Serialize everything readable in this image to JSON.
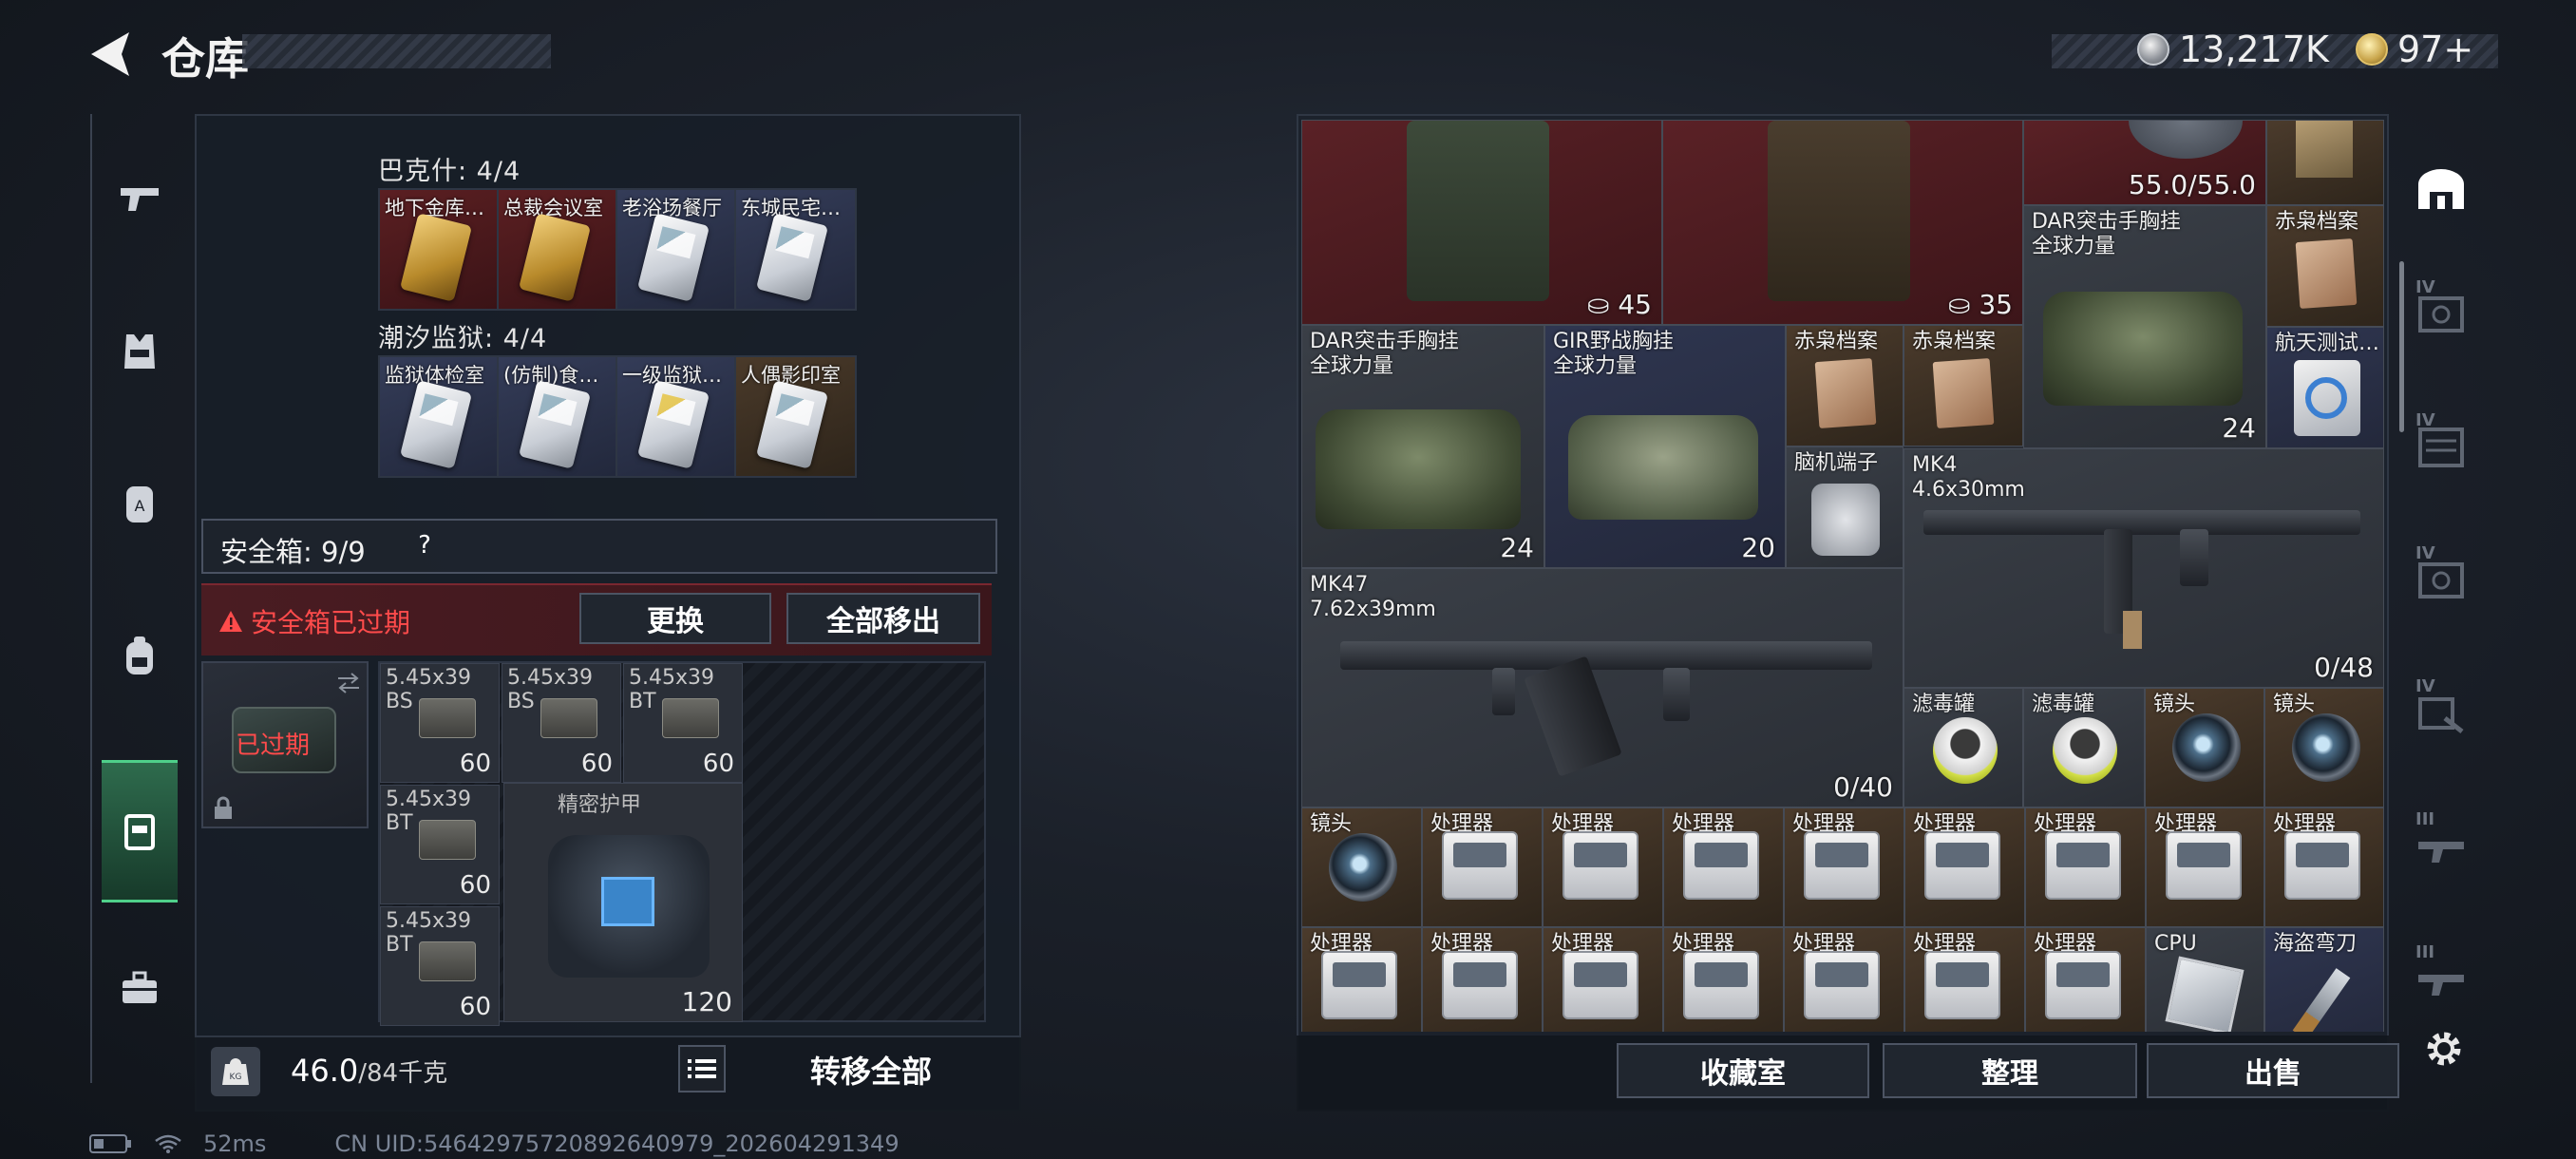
{
  "header": {
    "title": "仓库",
    "currency_main": "13,217K",
    "currency_secondary": "97+"
  },
  "side_nav": [
    "weapon",
    "armor-vest",
    "backpack-alt",
    "helmet",
    "backpack",
    "toolbox"
  ],
  "keycards": {
    "group1_label": "巴克什: 4/4",
    "group1": [
      {
        "label": "地下金库…",
        "color": "gold",
        "bg": "red"
      },
      {
        "label": "总裁会议室",
        "color": "gold",
        "bg": "red"
      },
      {
        "label": "老浴场餐厅",
        "color": "white",
        "bg": "blue"
      },
      {
        "label": "东城民宅…",
        "color": "white",
        "bg": "blue"
      }
    ],
    "group2_label": "潮汐监狱: 4/4",
    "group2": [
      {
        "label": "监狱体检室",
        "color": "white",
        "bg": "blue"
      },
      {
        "label": "(仿制)食…",
        "color": "white",
        "bg": "blue"
      },
      {
        "label": "一级监狱…",
        "color": "white",
        "bg": "blue"
      },
      {
        "label": "人偶影印室",
        "color": "white",
        "bg": "brown"
      }
    ]
  },
  "safebox": {
    "label": "安全箱: 9/9",
    "help": "?",
    "expired_notice": "安全箱已过期",
    "swap_label": "更换",
    "remove_all_label": "全部移出",
    "expired_tag": "已过期",
    "items": [
      {
        "label": "5.45x39 BS",
        "count": "60"
      },
      {
        "label": "5.45x39 BS",
        "count": "60"
      },
      {
        "label": "5.45x39 BT",
        "count": "60"
      },
      {
        "label": "5.45x39 BT",
        "count": "60"
      },
      {
        "label": "5.45x39 BT",
        "count": "60"
      }
    ],
    "armor": {
      "label": "精密护甲",
      "durability": "120"
    }
  },
  "weight": {
    "current": "46.0",
    "max": "/84千克"
  },
  "transfer_all_label": "转移全部",
  "status": {
    "ping": "52ms",
    "uid": "CN UID:5464297572089264097​9_202604291349"
  },
  "stash": {
    "rig_count_1": "45",
    "rig_count_2": "35",
    "durability": "55.0/55.0",
    "items": {
      "dar_top": {
        "name": "DAR突击手胸挂",
        "sub": "全球力量",
        "count": "24"
      },
      "chixiao_top": {
        "name": "赤枭档案"
      },
      "dar_mid": {
        "name": "DAR突击手胸挂",
        "sub": "全球力量",
        "count": "24"
      },
      "gir": {
        "name": "GIR野战胸挂",
        "sub": "全球力量",
        "count": "20"
      },
      "chixiao_1": {
        "name": "赤枭档案"
      },
      "chixiao_2": {
        "name": "赤枭档案"
      },
      "aerospace": {
        "name": "航天测试…"
      },
      "brain": {
        "name": "脑机端子"
      },
      "mk4": {
        "name": "MK4",
        "caliber": "4.6x30mm",
        "ammo": "0/48"
      },
      "mk47": {
        "name": "MK47",
        "caliber": "7.62x39mm",
        "ammo": "0/40"
      },
      "filter_1": {
        "name": "滤毒罐"
      },
      "filter_2": {
        "name": "滤毒罐"
      },
      "lens_1": {
        "name": "镜头"
      },
      "lens_2": {
        "name": "镜头"
      },
      "lens_3": {
        "name": "镜头"
      },
      "processor": "处理器",
      "cpu": "CPU",
      "knife": "海盗弯刀"
    }
  },
  "right_tabs": [
    {
      "tier": "",
      "icon": "stash"
    },
    {
      "tier": "IV",
      "icon": "safe"
    },
    {
      "tier": "IV",
      "icon": "cabinet"
    },
    {
      "tier": "IV",
      "icon": "safe"
    },
    {
      "tier": "IV",
      "icon": "tool"
    },
    {
      "tier": "III",
      "icon": "weapon-rack"
    },
    {
      "tier": "III",
      "icon": "weapon-rack"
    }
  ],
  "actions": {
    "collection": "收藏室",
    "organize": "整理",
    "sell": "出售"
  },
  "colors": {
    "expired_red": "#ff4b4b",
    "active_green": "#4fd08a",
    "item_red": "#5a2126",
    "item_blue": "#2f3650"
  }
}
